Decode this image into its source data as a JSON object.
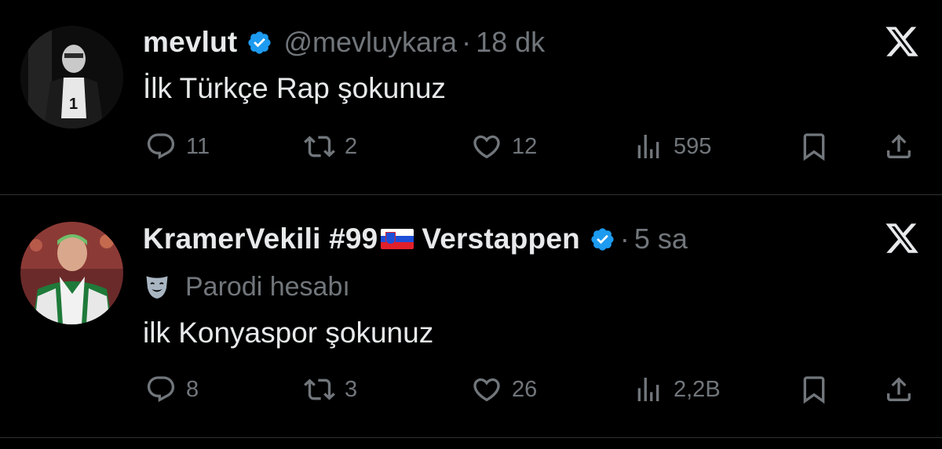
{
  "tweets": [
    {
      "display_name": "mevlut",
      "verified": true,
      "handle": "@mevluykara",
      "separator": "·",
      "time": "18 dk",
      "text": "İlk Türkçe Rap şokunuz",
      "avatar": "avatar-man-black-and-white",
      "stats": {
        "replies": "11",
        "retweets": "2",
        "likes": "12",
        "views": "595"
      }
    },
    {
      "display_name_part1": "KramerVekili #99",
      "flag": "slovenia-flag",
      "display_name_part2": "Verstappen",
      "verified": true,
      "separator": "·",
      "time": "5 sa",
      "parody_label": "Parodi hesabı",
      "text": "ilk Konyaspor şokunuz",
      "avatar": "avatar-footballer-green-jacket",
      "stats": {
        "replies": "8",
        "retweets": "3",
        "likes": "26",
        "views": "2,2B"
      }
    }
  ],
  "icons": {
    "reply": "reply-icon",
    "retweet": "retweet-icon",
    "like": "heart-icon",
    "views": "views-icon",
    "bookmark": "bookmark-icon",
    "share": "share-icon",
    "logo": "x-logo-icon",
    "verified": "verified-badge-icon",
    "parody": "theater-mask-icon"
  },
  "colors": {
    "background": "#000000",
    "text": "#e7e9ea",
    "secondary": "#71767b",
    "verified": "#1d9bf0",
    "divider": "#2f3336"
  }
}
